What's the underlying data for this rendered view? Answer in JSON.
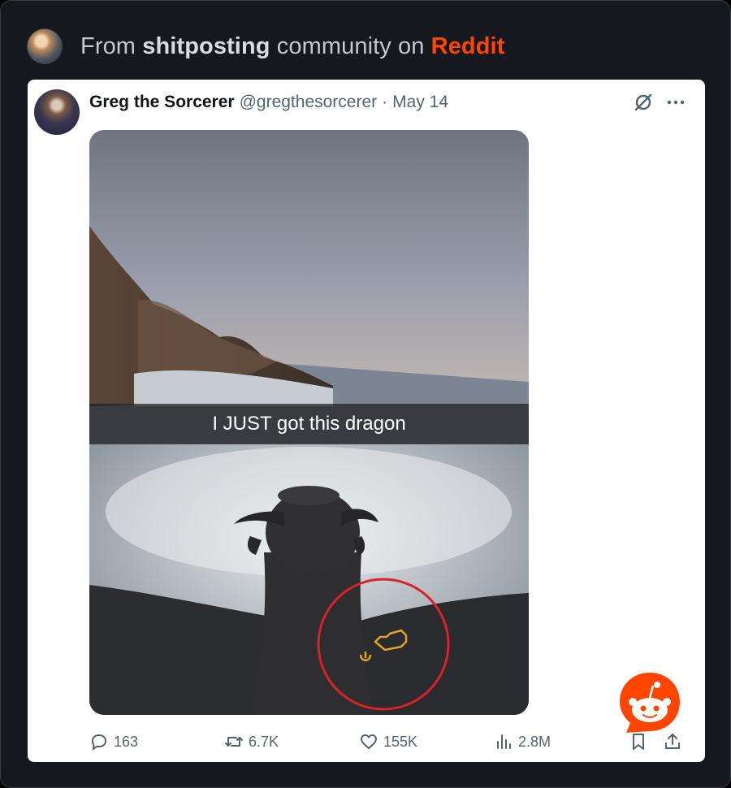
{
  "header": {
    "prefix": "From",
    "community": "shitposting",
    "middle": "community on",
    "platform": "Reddit"
  },
  "post": {
    "name": "Greg the Sorcerer",
    "handle": "@gregthesorcerer",
    "separator": "·",
    "date": "May 14",
    "caption": "I JUST got this dragon"
  },
  "actions": {
    "replies": "163",
    "reposts": "6.7K",
    "likes": "155K",
    "views": "2.8M"
  },
  "colors": {
    "reddit_orange": "#ff4500",
    "annotation_red": "#d8222a",
    "engine_light": "#e0a32a"
  }
}
